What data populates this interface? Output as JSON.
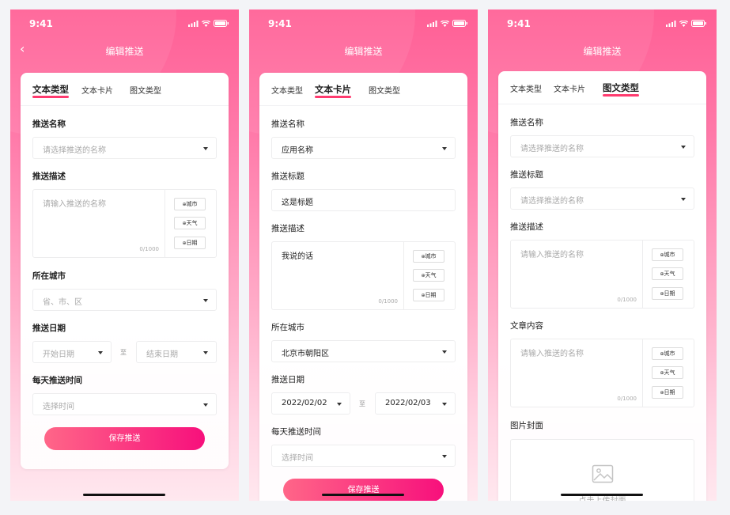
{
  "status": {
    "time": "9:41"
  },
  "nav": {
    "title": "编辑推送",
    "back": "‹"
  },
  "tabs": [
    "文本类型",
    "文本卡片",
    "图文类型"
  ],
  "chips": {
    "city": "城市",
    "weather": "天气",
    "date": "日期",
    "at": "⊕"
  },
  "range_sep": "至",
  "count": "0/1000",
  "save_label": "保存推送",
  "colors": {
    "accent": "#ff3b6f",
    "button_start": "#ff6688",
    "button_end": "#f7107c"
  },
  "screen1": {
    "name_label": "推送名称",
    "name_placeholder": "请选择推送的名称",
    "desc_label": "推送描述",
    "desc_placeholder": "请输入推送的名称",
    "city_label": "所在城市",
    "city_placeholder": "省、市、区",
    "date_label": "推送日期",
    "start_placeholder": "开始日期",
    "end_placeholder": "结束日期",
    "time_label": "每天推送时间",
    "time_placeholder": "选择时间"
  },
  "screen2": {
    "name_label": "推送名称",
    "name_value": "应用名称",
    "title_label": "推送标题",
    "title_value": "这是标题",
    "desc_label": "推送描述",
    "desc_value": "我说的话",
    "city_label": "所在城市",
    "city_value": "北京市朝阳区",
    "date_label": "推送日期",
    "start_value": "2022/02/02",
    "end_value": "2022/02/03",
    "time_label": "每天推送时间",
    "time_placeholder": "选择时间"
  },
  "screen3": {
    "name_label": "推送名称",
    "name_placeholder": "请选择推送的名称",
    "title_label": "推送标题",
    "title_placeholder": "请选择推送的名称",
    "desc_label": "推送描述",
    "desc_placeholder": "请输入推送的名称",
    "content_label": "文章内容",
    "content_placeholder": "请输入推送的名称",
    "cover_label": "图片封面",
    "cover_hint": "点击上传封面"
  }
}
